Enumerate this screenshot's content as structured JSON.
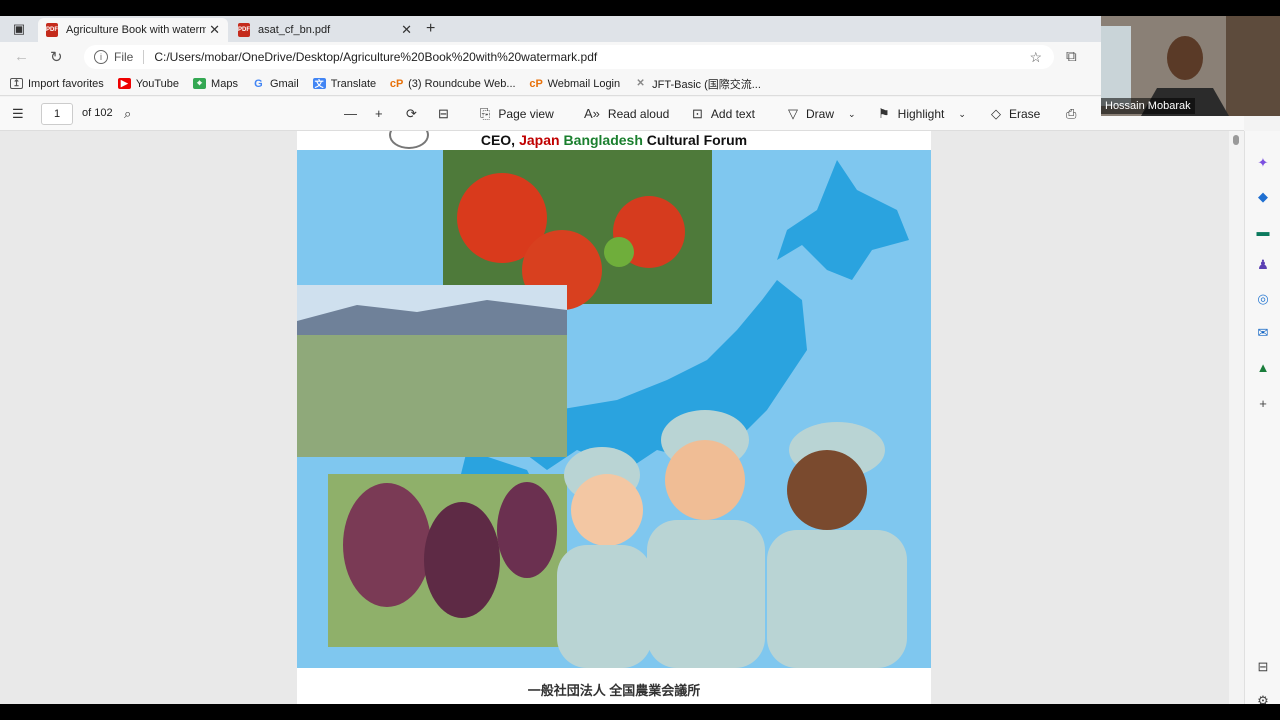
{
  "browser": {
    "tabs": [
      {
        "label": "Agriculture Book with watermark",
        "active": true
      },
      {
        "label": "asat_cf_bn.pdf",
        "active": false
      }
    ],
    "address": {
      "scheme_label": "File",
      "url": "C:/Users/mobar/OneDrive/Desktop/Agriculture%20Book%20with%20watermark.pdf"
    },
    "bookmarks": [
      {
        "label": "Import favorites",
        "icon": "import-icon"
      },
      {
        "label": "YouTube",
        "icon": "youtube-icon"
      },
      {
        "label": "Maps",
        "icon": "maps-icon"
      },
      {
        "label": "Gmail",
        "icon": "google-icon"
      },
      {
        "label": "Translate",
        "icon": "translate-icon"
      },
      {
        "label": "(3) Roundcube Web...",
        "icon": "roundcube-icon"
      },
      {
        "label": "Webmail Login",
        "icon": "roundcube-icon"
      },
      {
        "label": "JFT-Basic (国際交流...",
        "icon": "jft-icon"
      }
    ]
  },
  "pdf_toolbar": {
    "page_number": "1",
    "page_total": "of 102",
    "page_view": "Page view",
    "read_aloud": "Read aloud",
    "add_text": "Add text",
    "draw": "Draw",
    "highlight": "Highlight",
    "erase": "Erase"
  },
  "document": {
    "header_prefix": "CEO, ",
    "header_japan": "Japan",
    "header_bangladesh": "Bangladesh",
    "header_suffix": " Cultural Forum",
    "footer_japanese": "一般社団法人 全国農業会議所"
  },
  "webcam": {
    "participant_name": "Hossain Mobarak"
  },
  "colors": {
    "accent_red": "#c00000",
    "accent_green": "#1a7f2e",
    "cover_blue": "#7fc7ef",
    "map_blue": "#2aa3df"
  }
}
